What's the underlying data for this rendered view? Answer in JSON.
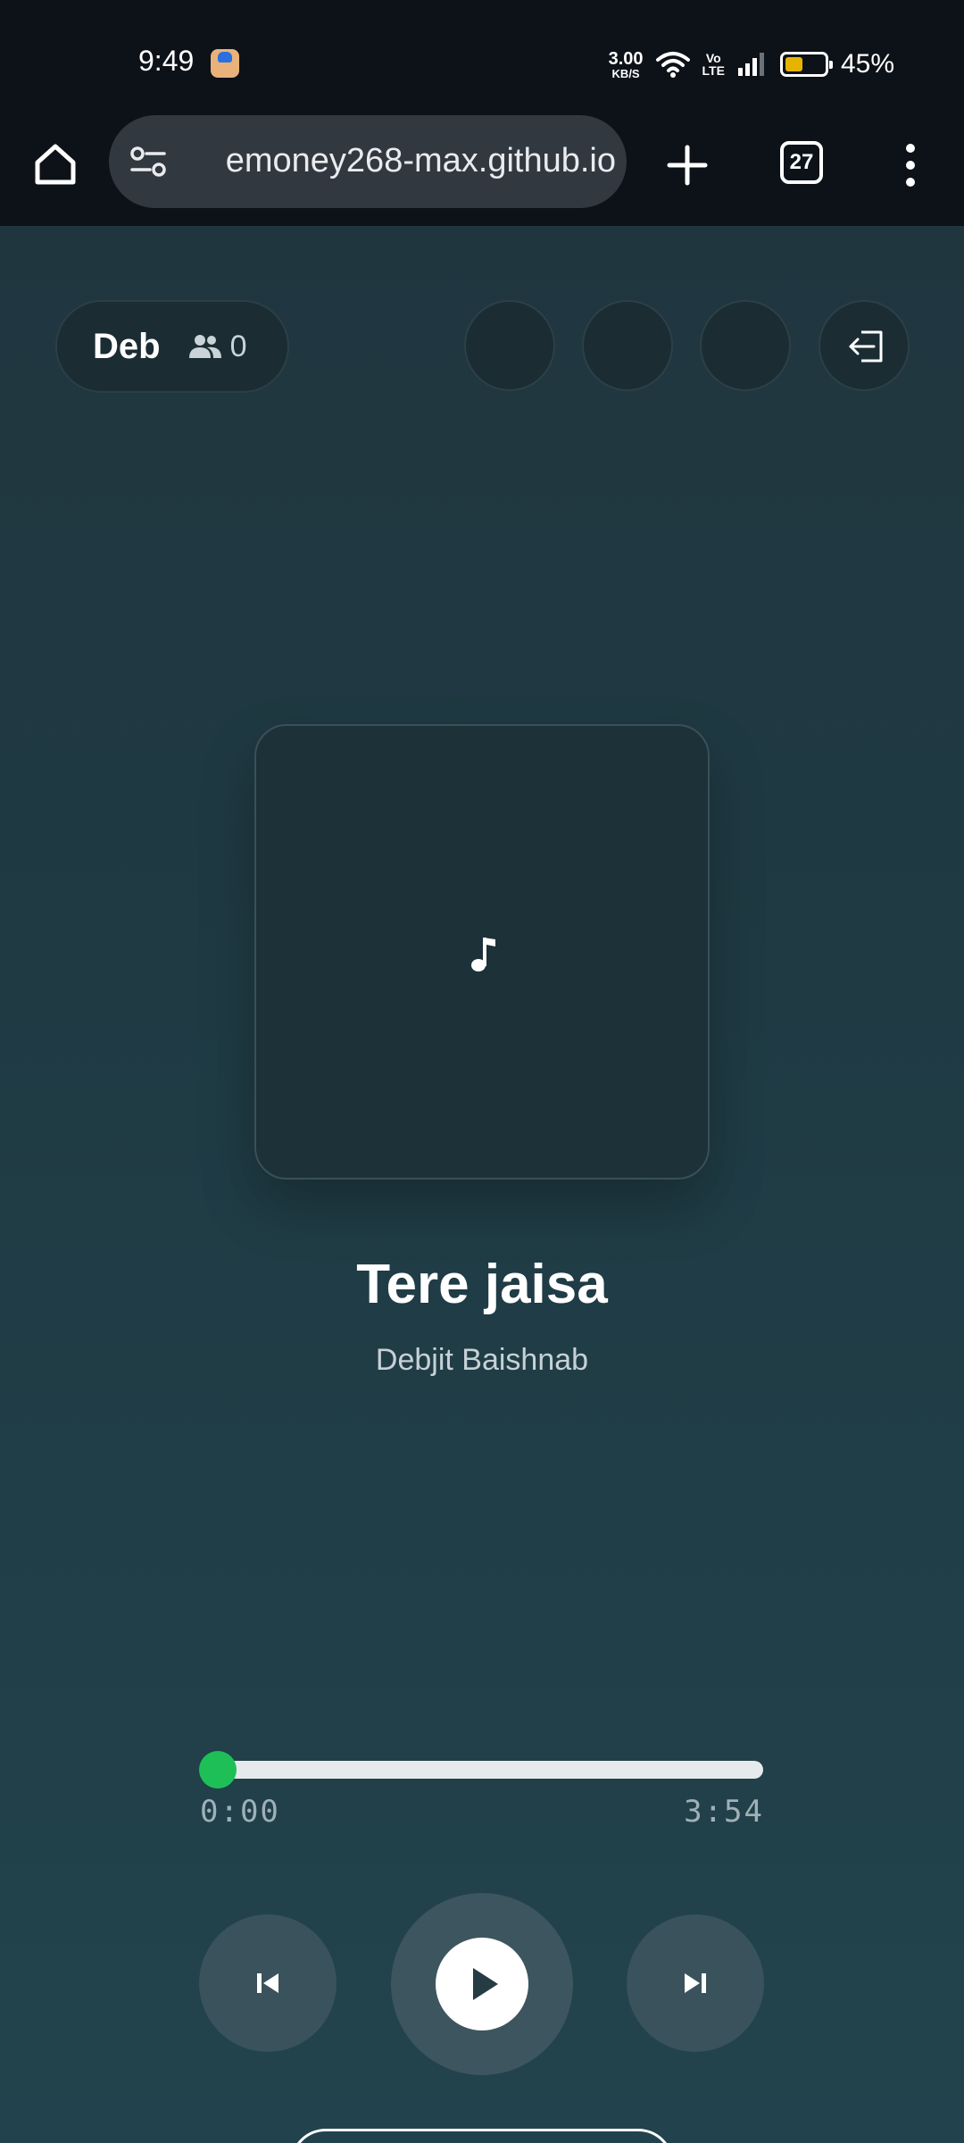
{
  "status_bar": {
    "time": "9:49",
    "net_speed_value": "3.00",
    "net_speed_unit": "KB/S",
    "volte_top": "Vo",
    "volte_bottom": "LTE",
    "battery_percent": "45%",
    "battery_level": 0.45,
    "battery_color": "#e6b400",
    "icons": [
      "app-notification-icon",
      "wifi-icon",
      "signal-icon",
      "battery-icon"
    ]
  },
  "browser": {
    "url": "emoney268-max.github.io",
    "tab_count": "27",
    "icons": [
      "home-icon",
      "site-settings-icon",
      "new-tab-icon",
      "tabs-icon",
      "more-menu-icon"
    ]
  },
  "app": {
    "user_name": "Deb",
    "listeners_count": "0",
    "song": {
      "title": "Tere jaisa",
      "artist": "Debjit Baishnab"
    },
    "player": {
      "current_time": "0:00",
      "total_time": "3:54",
      "progress": 0.0,
      "accent_color": "#1fbf58"
    },
    "icons": [
      "listeners-icon",
      "logout-icon",
      "music-note-icon",
      "previous-icon",
      "play-icon",
      "next-icon"
    ]
  }
}
